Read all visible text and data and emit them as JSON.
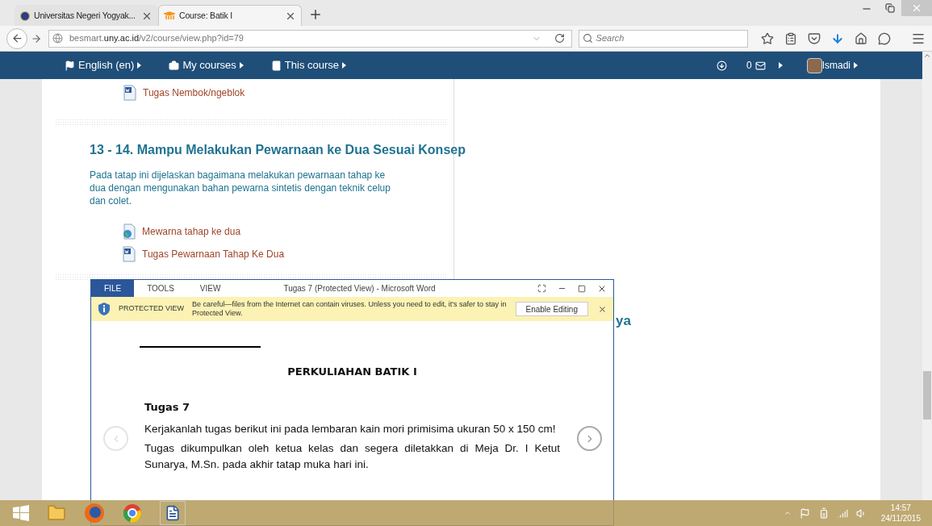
{
  "browser": {
    "tabs": [
      {
        "title": "Universitas Negeri Yogyak...",
        "selected": false
      },
      {
        "title": "Course: Batik I",
        "selected": true
      }
    ],
    "url": {
      "subdomain": "besmart.",
      "domain": "uny.ac.id",
      "path": "/v2/course/view.php?id=79"
    },
    "search": {
      "placeholder": "Search"
    }
  },
  "site_nav": {
    "menus": [
      {
        "kind": "language",
        "label": "English (en)"
      },
      {
        "kind": "courses",
        "label": "My courses"
      },
      {
        "kind": "course",
        "label": "This course"
      }
    ],
    "messages_count": "0",
    "user": "Ismadi"
  },
  "course": {
    "top_items": [
      {
        "kind": "word",
        "label": "Tugas Nembok/ngeblok"
      }
    ],
    "section": {
      "title": "13 - 14. Mampu Melakukan Pewarnaan ke Dua Sesuai Konsep",
      "summary": "Pada tatap ini dijelaskan bagaimana melakukan pewarnaan tahap ke dua dengan mengunakan bahan pewarna sintetis dengan teknik celup dan colet.",
      "items": [
        {
          "kind": "page",
          "label": "Mewarna tahap ke dua"
        },
        {
          "kind": "word",
          "label": "Tugas Pewarnaan Tahap Ke Dua"
        }
      ]
    },
    "next_section_title": "ya"
  },
  "word": {
    "ribbon_tabs": [
      {
        "label": "FILE",
        "selected": true
      },
      {
        "label": "TOOLS",
        "selected": false
      },
      {
        "label": "VIEW",
        "selected": false
      }
    ],
    "title": "Tugas 7 (Protected View) - Microsoft Word",
    "protected": {
      "label": "PROTECTED VIEW",
      "message": "Be careful—files from the Internet can contain viruses. Unless you need to edit, it's safer to stay in Protected View.",
      "button": "Enable Editing"
    },
    "document": {
      "heading": "PERKULIAHAN BATIK I",
      "subheading": "Tugas 7",
      "paragraphs": [
        "Kerjakanlah tugas berikut ini pada lembaran kain mori primisima ukuran 50 x 150 cm!",
        "Tugas dikumpulkan oleh ketua kelas dan segera diletakkan di Meja Dr. I Ketut Sunarya, M.Sn. pada akhir tatap muka hari ini."
      ]
    }
  },
  "taskbar": {
    "time": "14:57",
    "date": "24/11/2015"
  }
}
